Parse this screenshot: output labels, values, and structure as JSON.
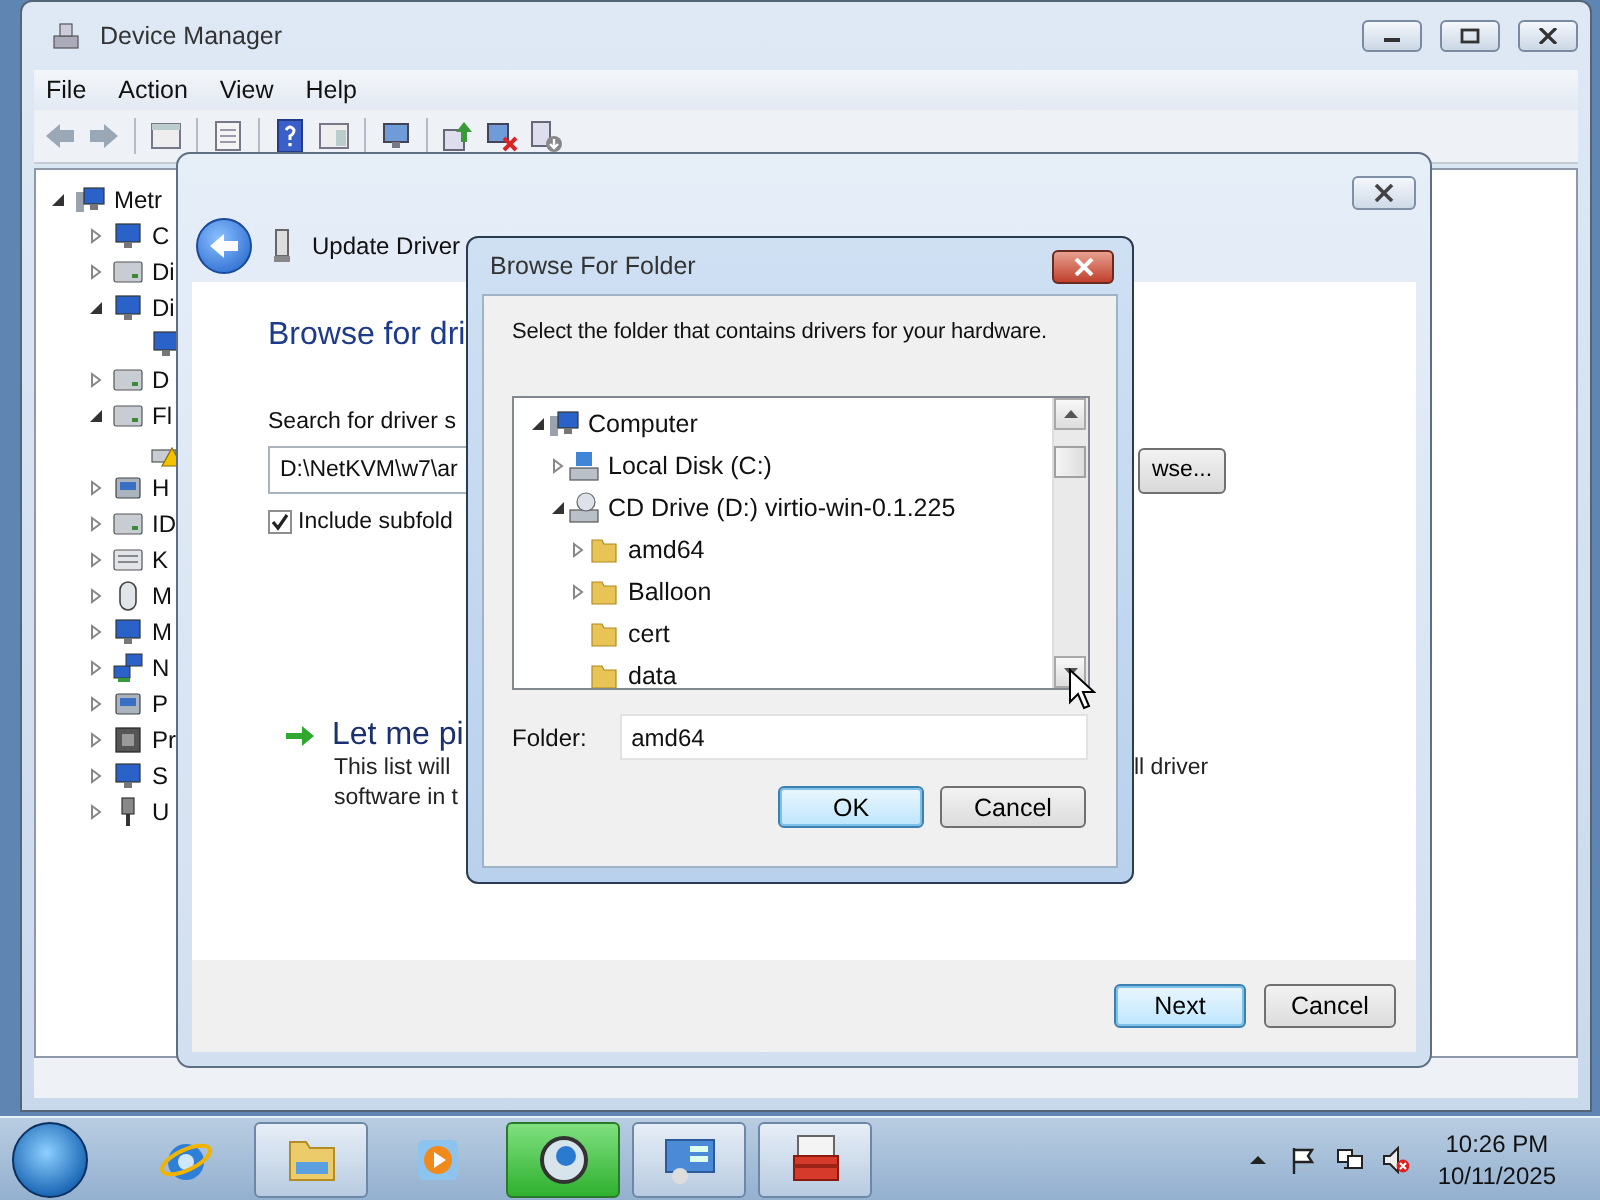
{
  "device_manager": {
    "title": "Device Manager",
    "menu": [
      "File",
      "Action",
      "View",
      "Help"
    ],
    "tree": [
      {
        "label": "Metr",
        "kind": "computer",
        "expanded": true,
        "children": [
          {
            "label": "C",
            "kind": "monitor",
            "expanded": false
          },
          {
            "label": "Di",
            "kind": "drive",
            "expanded": false
          },
          {
            "label": "Di",
            "kind": "monitor",
            "expanded": true,
            "children": [
              {
                "kind": "monitor"
              }
            ]
          },
          {
            "label": "D",
            "kind": "drive",
            "expanded": false
          },
          {
            "label": "Fl",
            "kind": "drive",
            "expanded": true,
            "children": [
              {
                "kind": "warning"
              }
            ]
          },
          {
            "label": "H",
            "kind": "device",
            "expanded": false
          },
          {
            "label": "ID",
            "kind": "drive",
            "expanded": false
          },
          {
            "label": "K",
            "kind": "keyboard",
            "expanded": false
          },
          {
            "label": "M",
            "kind": "mouse",
            "expanded": false
          },
          {
            "label": "M",
            "kind": "monitor",
            "expanded": false
          },
          {
            "label": "N",
            "kind": "network",
            "expanded": false
          },
          {
            "label": "P",
            "kind": "device",
            "expanded": false
          },
          {
            "label": "Pr",
            "kind": "chip",
            "expanded": false
          },
          {
            "label": "S",
            "kind": "monitor",
            "expanded": false
          },
          {
            "label": "U",
            "kind": "plug",
            "expanded": false
          }
        ]
      }
    ]
  },
  "wizard": {
    "title": "Update Driver",
    "heading": "Browse for dri",
    "search_label": "Search for driver s",
    "path": "D:\\NetKVM\\w7\\ar",
    "browse_button": "wse...",
    "include_subfolders": {
      "label": "Include subfold",
      "checked": true
    },
    "pick_link": "Let me pi",
    "description": [
      {
        "left": "This list will",
        "right": "ll driver"
      },
      {
        "left": "software in t"
      }
    ],
    "buttons": [
      {
        "label": "Next",
        "default": true
      },
      {
        "label": "Cancel",
        "default": false
      }
    ]
  },
  "browse_dialog": {
    "title": "Browse For Folder",
    "instruction": "Select the folder that contains drivers for your hardware.",
    "tree": [
      {
        "label": "Computer",
        "kind": "computer",
        "expanded": true,
        "children": [
          {
            "label": "Local Disk (C:)",
            "kind": "disk",
            "expanded": false
          },
          {
            "label": "CD Drive (D:) virtio-win-0.1.225",
            "kind": "cd",
            "expanded": true,
            "children": [
              {
                "label": "amd64",
                "kind": "folder",
                "expanded": false
              },
              {
                "label": "Balloon",
                "kind": "folder",
                "expanded": false
              },
              {
                "label": "cert",
                "kind": "folder"
              },
              {
                "label": "data",
                "kind": "folder"
              }
            ]
          }
        ]
      }
    ],
    "folder_label": "Folder:",
    "folder": "amd64",
    "buttons": [
      {
        "label": "OK",
        "default": true
      },
      {
        "label": "Cancel",
        "default": false
      }
    ]
  },
  "taskbar": {
    "apps": [
      {
        "kind": "ie",
        "running": false,
        "highlighted": false
      },
      {
        "kind": "folder",
        "running": true,
        "highlighted": false
      },
      {
        "kind": "media",
        "running": false,
        "highlighted": false
      },
      {
        "kind": "chrome",
        "running": true,
        "highlighted": true
      },
      {
        "kind": "control",
        "running": true,
        "highlighted": false
      },
      {
        "kind": "toolbox",
        "running": true,
        "highlighted": false
      }
    ],
    "clock": {
      "time": "10:26 PM",
      "date": "10/11/2025"
    }
  }
}
